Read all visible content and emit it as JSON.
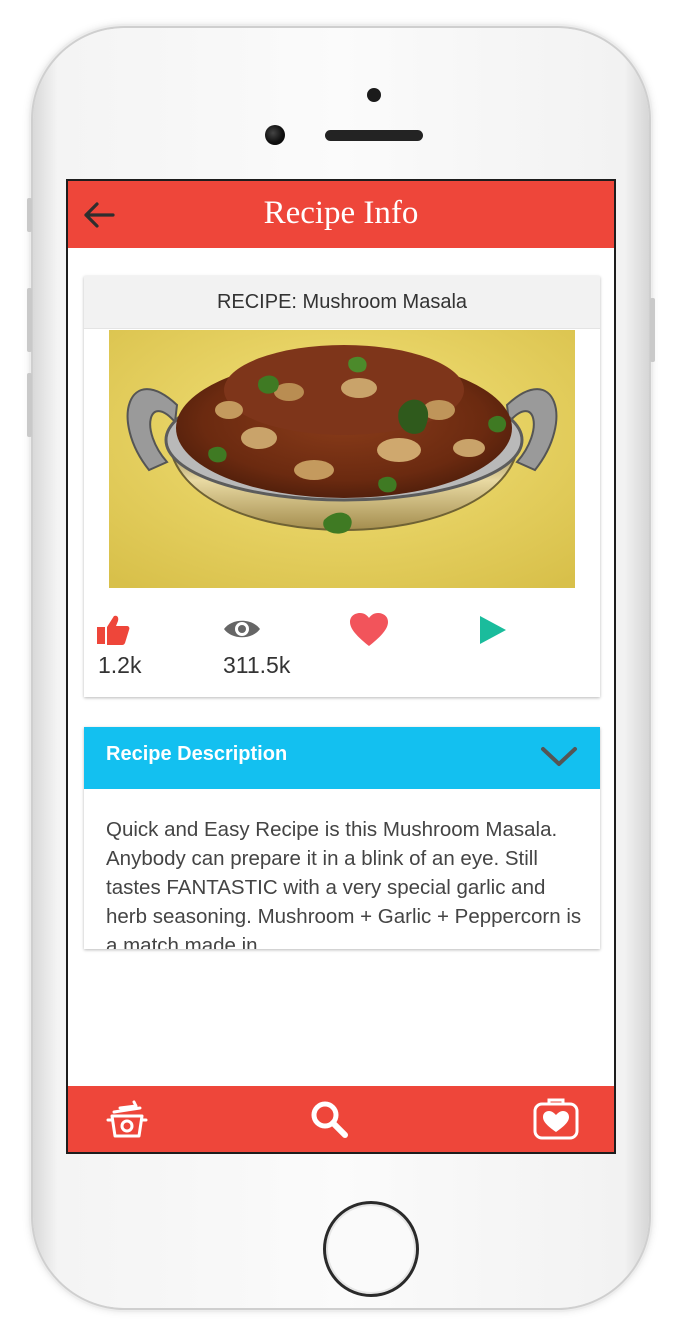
{
  "header": {
    "title": "Recipe Info"
  },
  "recipe": {
    "heading": "RECIPE: Mushroom Masala"
  },
  "stats": {
    "likes": "1.2k",
    "views": "311.5k"
  },
  "description": {
    "header": "Recipe Description",
    "text": "Quick and Easy Recipe is this Mushroom Masala. Anybody can prepare it in a blink of an eye. Still tastes FANTASTIC with a very special garlic and herb seasoning. Mushroom + Garlic + Peppercorn is a match made in"
  },
  "colors": {
    "header": "#ee463a",
    "description_header": "#13c0f0",
    "like": "#ee463a",
    "heart": "#f2545b",
    "play": "#1abc9c"
  },
  "icons": {
    "back": "arrow-left-icon",
    "like": "thumbs-up-icon",
    "views": "eye-icon",
    "favorite": "heart-icon",
    "play": "play-icon",
    "expand": "chevron-down-icon",
    "cooking": "cooking-pot-icon",
    "search": "search-icon",
    "saved": "heart-bag-icon"
  }
}
